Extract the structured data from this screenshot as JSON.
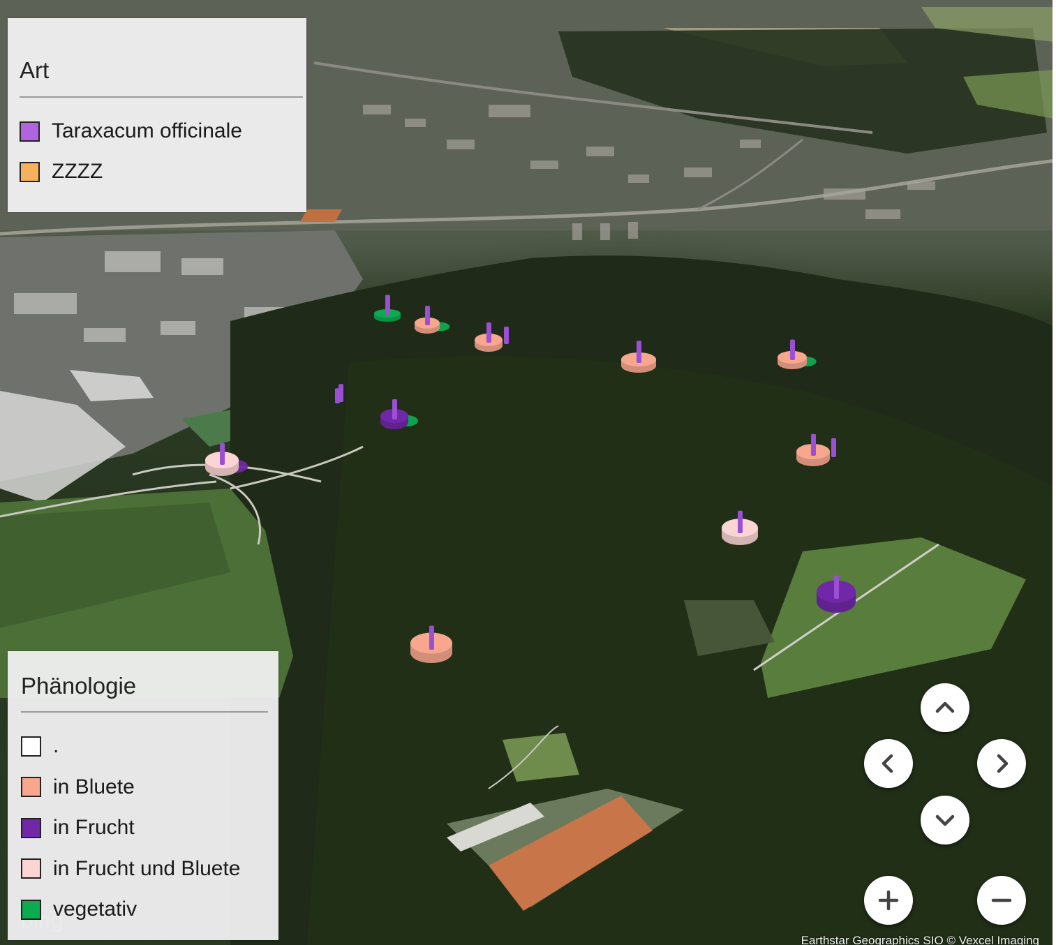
{
  "legend_species": {
    "title": "Art",
    "items": [
      {
        "label": "Taraxacum officinale",
        "color": "#b164e0"
      },
      {
        "label": "ZZZZ",
        "color": "#f7b15d"
      }
    ]
  },
  "legend_phenology": {
    "title": "Phänologie",
    "items": [
      {
        "label": ".",
        "color": "#ffffff"
      },
      {
        "label": "in Bluete",
        "color": "#f7a78e"
      },
      {
        "label": "in Frucht",
        "color": "#7028a8"
      },
      {
        "label": "in Frucht und Bluete",
        "color": "#fbd4d4"
      },
      {
        "label": "vegetativ",
        "color": "#0cab50"
      }
    ]
  },
  "map": {
    "attribution": "Earthstar Geographics  SIO  © Vexcel Imaging",
    "brand": "bing"
  },
  "markers": [
    {
      "base": "vegetativ"
    },
    {
      "base": "in Bluete"
    },
    {
      "base": "in Bluete"
    },
    {
      "base": "in Bluete"
    },
    {
      "base": "in Bluete"
    },
    {
      "base": "in Frucht"
    },
    {
      "base": "in Frucht"
    },
    {
      "base": "in Frucht und Bluete"
    },
    {
      "base": "in Bluete"
    },
    {
      "base": "in Frucht und Bluete"
    },
    {
      "base": "in Frucht"
    },
    {
      "base": "in Bluete"
    }
  ],
  "navigation": {
    "pan_up": "pan-up",
    "pan_left": "pan-left",
    "pan_right": "pan-right",
    "pan_down": "pan-down",
    "zoom_in": "zoom-in",
    "zoom_out": "zoom-out"
  }
}
